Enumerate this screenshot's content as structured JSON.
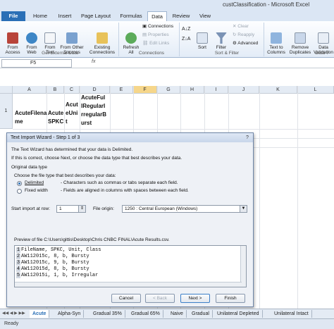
{
  "window": {
    "title": "custClassification - Microsoft Excel"
  },
  "tabs": [
    "File",
    "Home",
    "Insert",
    "Page Layout",
    "Formulas",
    "Data",
    "Review",
    "View"
  ],
  "ribbon": {
    "buttons": [
      {
        "label": "From\nAccess"
      },
      {
        "label": "From\nWeb"
      },
      {
        "label": "From\nText"
      },
      {
        "label": "From Other\nSources"
      },
      {
        "label": "Existing\nConnections"
      },
      {
        "label": "Refresh\nAll"
      },
      {
        "label": "Sort"
      },
      {
        "label": "Filter"
      },
      {
        "label": "Text to\nColumns"
      },
      {
        "label": "Remove\nDuplicates"
      },
      {
        "label": "Data\nValidation"
      }
    ],
    "small": {
      "connections": "Connections",
      "properties": "Properties",
      "edit_links": "Edit Links",
      "clear": "Clear",
      "reapply": "Reapply",
      "advanced": "Advanced"
    },
    "groups": {
      "get_external": "Get External Data",
      "connections": "Connections",
      "sort_filter": "Sort & Filter",
      "data_tools": "Data T"
    }
  },
  "formula_bar": {
    "cell_ref": "F5",
    "fx": "fx"
  },
  "columns": [
    "A",
    "B",
    "C",
    "D",
    "E",
    "F",
    "G",
    "H",
    "I",
    "J",
    "K",
    "L"
  ],
  "rows": [
    "1",
    "2",
    "3",
    "4",
    "5",
    "6",
    "7",
    "8",
    "9",
    "10",
    "11",
    "12",
    "13",
    "14",
    "15",
    "16",
    "17",
    "18",
    "19",
    "20",
    "21"
  ],
  "cells": {
    "a1": [
      "AcuteFilena",
      "me"
    ],
    "b1": [
      "Acute",
      "SPKC"
    ],
    "c1": [
      "Acut",
      "eUni",
      "t"
    ],
    "d1": [
      "AcuteFul",
      "lRegularI",
      "rregularB",
      "urst"
    ]
  },
  "dialog": {
    "title": "Text Import Wizard - Step 1 of 3",
    "close": "?",
    "line1": "The Text Wizard has determined that your data is Delimited.",
    "line2": "If this is correct, choose Next, or choose the data type that best describes your data.",
    "group_label": "Original data type",
    "choose_label": "Choose the file type that best describes your data:",
    "opt1": "Delimited",
    "opt1_desc": "- Characters such as commas or tabs separate each field.",
    "opt2": "Fixed width",
    "opt2_desc": "- Fields are aligned in columns with spaces between each field.",
    "start_row_label": "Start import at row:",
    "start_row_value": "1",
    "origin_label": "File origin:",
    "origin_value": "1250 : Central European (Windows)",
    "preview_label": "Preview of file C:\\Users\\gittis\\Desktop\\Chris CNBC FINAL\\Acute Results.csv.",
    "preview_lines": [
      {
        "n": "1",
        "t": "FileName, SPKC, Unit, Class"
      },
      {
        "n": "2",
        "t": "AW112015c,  8, b, Bursty"
      },
      {
        "n": "3",
        "t": "AW112015c,  9, b, Bursty"
      },
      {
        "n": "4",
        "t": "AW112015d,  8, b, Bursty"
      },
      {
        "n": "5",
        "t": "AW112015i,  1, b, Irregular"
      }
    ],
    "buttons": {
      "cancel": "Cancel",
      "back": "< Back",
      "next": "Next >",
      "finish": "Finish"
    }
  },
  "sheet_tabs": [
    "Acute",
    "Alpha-Syn",
    "Gradual 35%",
    "Gradual 65%",
    "Naive",
    "Gradual",
    "Unilateral Depleted",
    "Unilateral Intact"
  ],
  "status": "Ready"
}
